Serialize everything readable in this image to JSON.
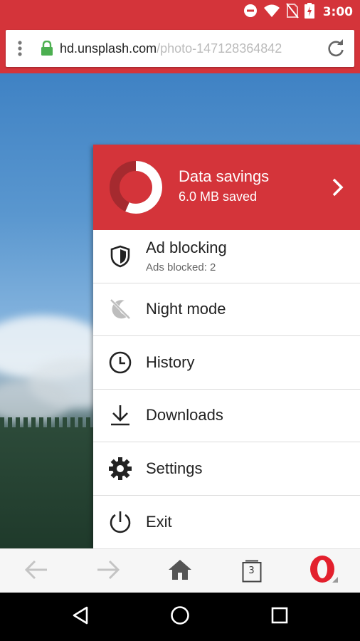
{
  "status_bar": {
    "time": "3:00"
  },
  "address_bar": {
    "domain": "hd.unsplash.com",
    "path": "/photo-147128364842"
  },
  "menu": {
    "data_savings": {
      "title": "Data savings",
      "subtitle": "6.0 MB saved"
    },
    "items": [
      {
        "label": "Ad blocking",
        "sublabel": "Ads blocked: 2",
        "icon": "shield-icon"
      },
      {
        "label": "Night mode",
        "icon": "moon-off-icon"
      },
      {
        "label": "History",
        "icon": "clock-icon"
      },
      {
        "label": "Downloads",
        "icon": "download-icon"
      },
      {
        "label": "Settings",
        "icon": "gear-icon"
      },
      {
        "label": "Exit",
        "icon": "power-icon"
      }
    ]
  },
  "bottom_bar": {
    "tab_count": "3"
  },
  "colors": {
    "accent": "#d4343a",
    "icon": "#222222",
    "disabled_icon": "#bdbdbd"
  }
}
